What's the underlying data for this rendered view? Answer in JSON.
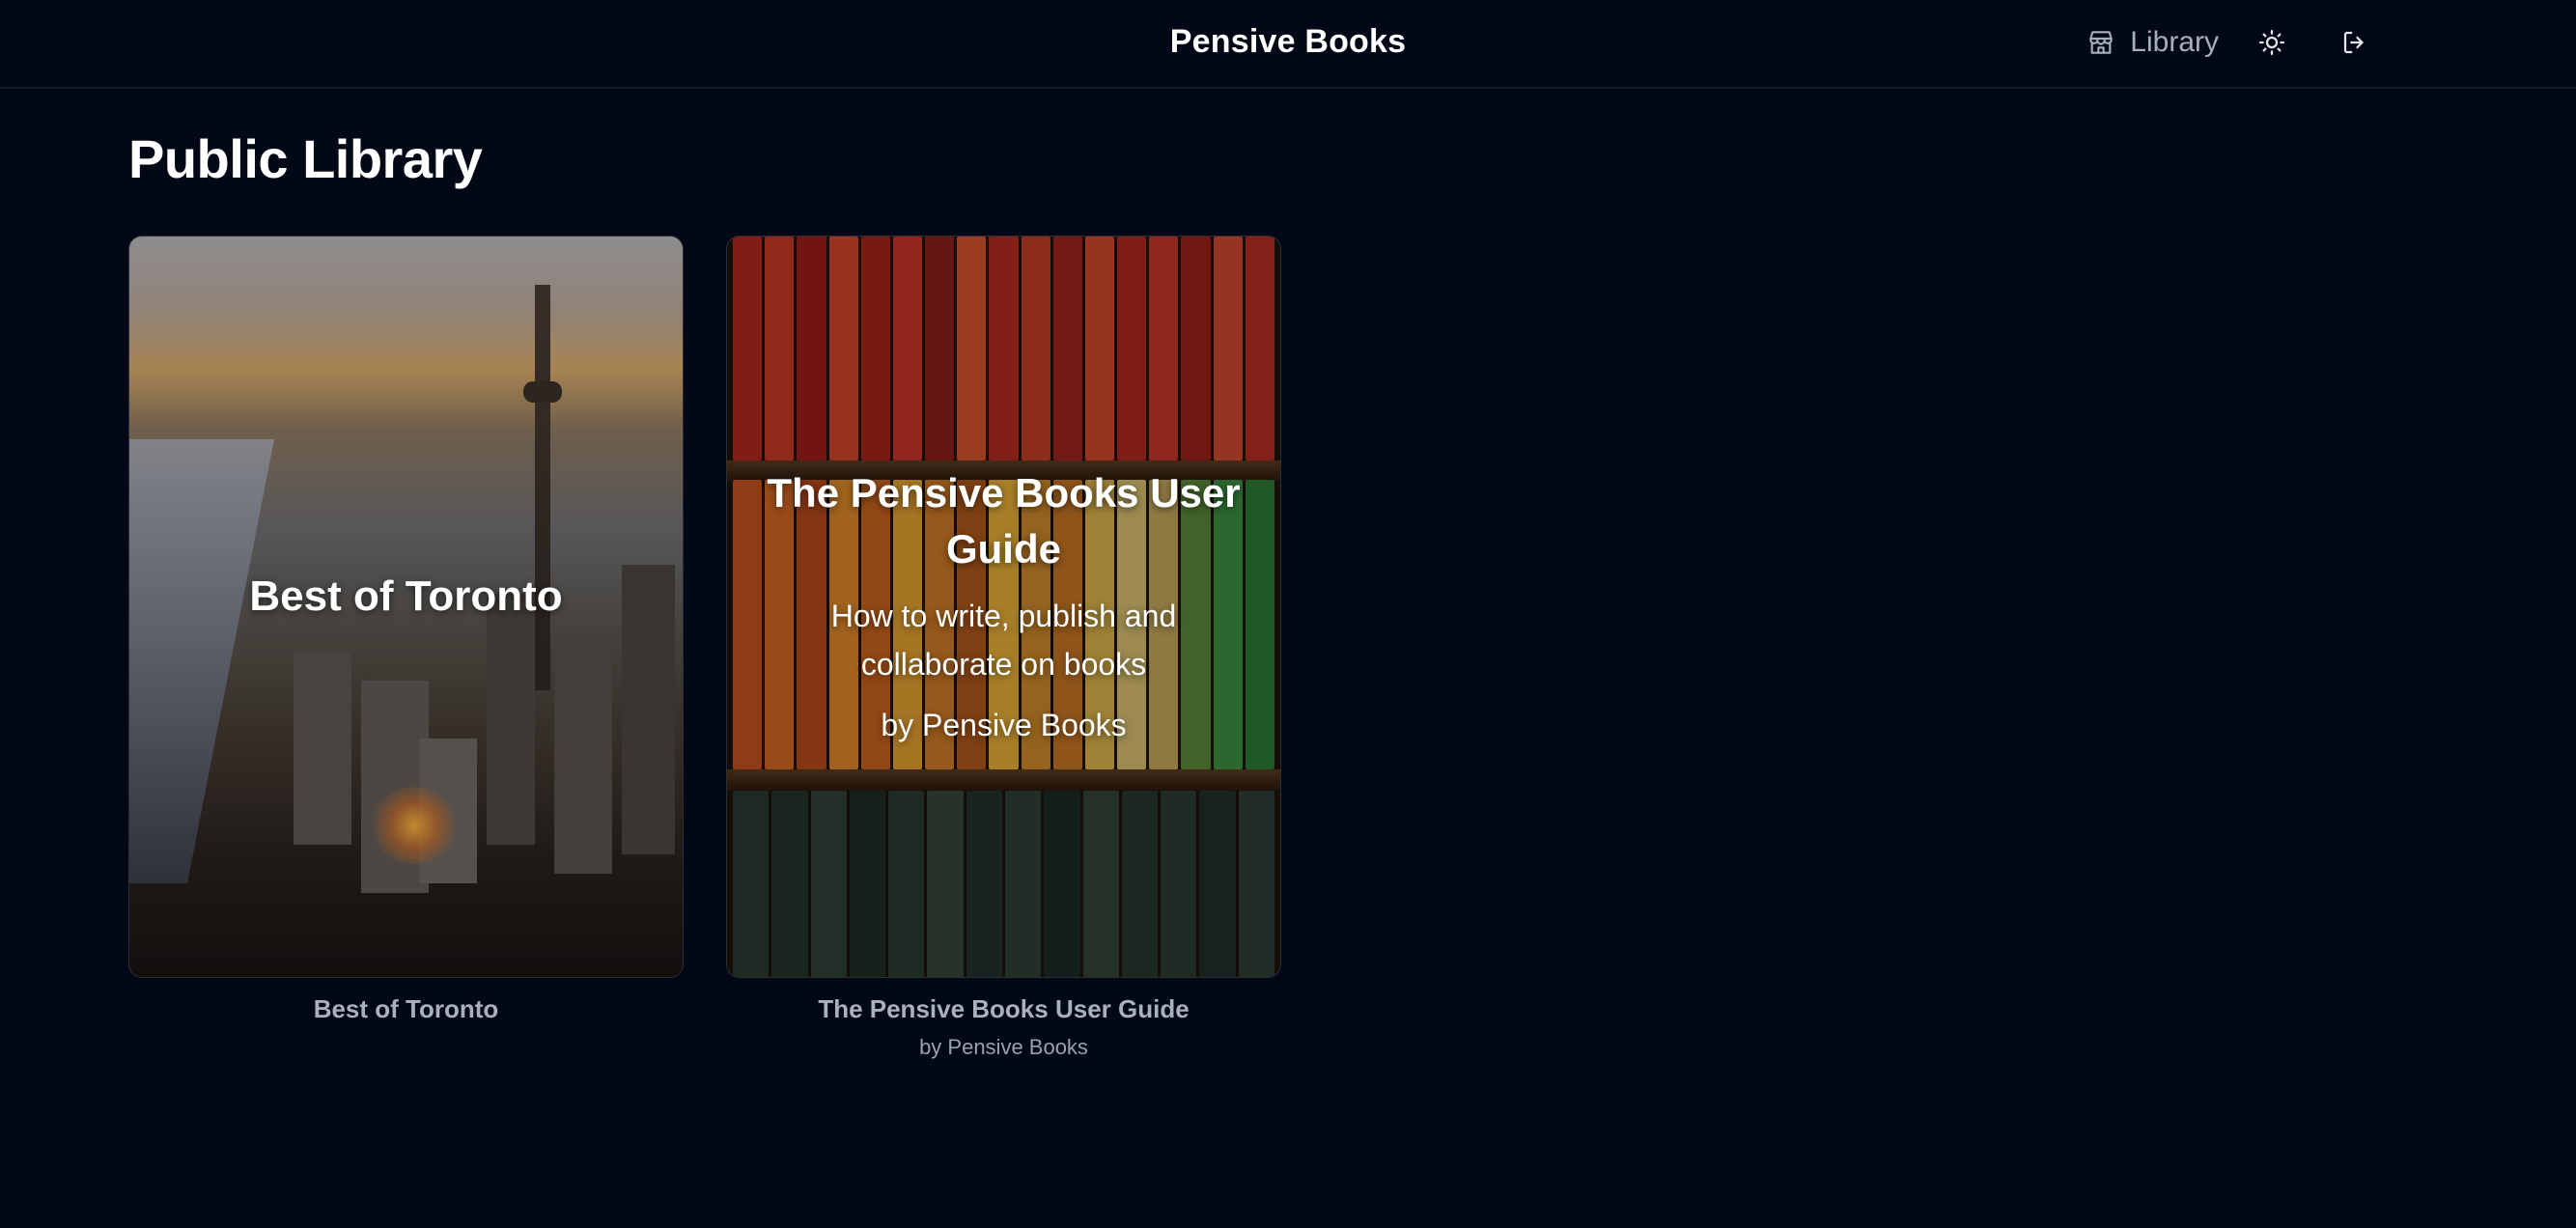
{
  "header": {
    "brand": "Pensive Books",
    "nav_library_label": "Library",
    "icons": {
      "library": "store-icon",
      "theme": "sun-icon",
      "logout": "logout-icon"
    }
  },
  "page": {
    "title": "Public Library"
  },
  "books": [
    {
      "cover_title": "Best of Toronto",
      "title": "Best of Toronto"
    },
    {
      "cover_title": "The Pensive Books User Guide",
      "cover_subtitle": "How to write, publish and collaborate on books",
      "cover_author": "by Pensive Books",
      "title": "The Pensive Books User Guide",
      "author": "by Pensive Books"
    }
  ],
  "colors": {
    "background": "#030816",
    "text_primary": "#ffffff",
    "text_muted": "#aab0bc"
  }
}
